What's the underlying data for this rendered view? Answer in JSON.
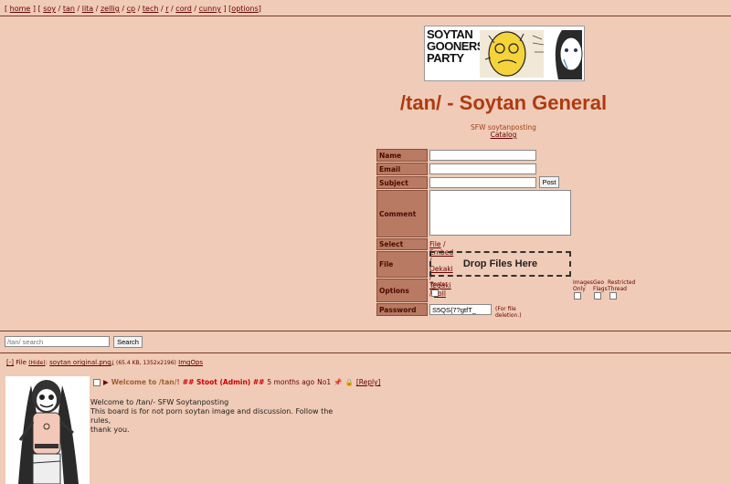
{
  "topnav": {
    "open": "[",
    "home": "home",
    "sep_close_open": "] [",
    "boards": [
      "soy",
      "tan",
      "lita",
      "zellig",
      "cp",
      "tech",
      "r",
      "cord",
      "cunny"
    ],
    "close_open": "] [",
    "options": "options",
    "close": "]"
  },
  "banner": {
    "text_lines": [
      "SOYTAN",
      "GOONERS",
      "PARTY"
    ]
  },
  "board": {
    "title": "/tan/ - Soytan General",
    "subtitle": "SFW soytanposting",
    "catalog": "Catalog"
  },
  "form": {
    "name_label": "Name",
    "email_label": "Email",
    "subject_label": "Subject",
    "post_button": "Post",
    "comment_label": "Comment",
    "select_label": "Select",
    "select_options": [
      "File",
      "Embed",
      "Oekaki",
      "Tegaki",
      "Poll"
    ],
    "file_label": "File",
    "drop_text": "Drop Files Here",
    "options_label": "Options",
    "poster_ids": "Poster IDs",
    "images_only_1": "Images",
    "images_only_2": "Only",
    "geo_flags_1": "Geo",
    "geo_flags_2": "Flags",
    "restricted_1": "Restricted",
    "restricted_2": "Thread",
    "password_label": "Password",
    "password_value": "S5QS{7?gtfT_",
    "password_note": "(For file deletion.)"
  },
  "search": {
    "placeholder": "/tan/ search",
    "button": "Search"
  },
  "thread": {
    "file_toggle": "[-]",
    "file_word": "File",
    "hide": "(Hide)",
    "colon": ":",
    "filename": "soytan original.png",
    "filesize": "(65.4 KB, 1352x2196)",
    "imgops": "ImgOps",
    "subject": "Welcome to /tan/!",
    "name": "## Stoot (Admin) ##",
    "time": "5 months ago",
    "post_no": "No1",
    "reply": "[Reply]",
    "body_line1": "Welcome to /tan/- SFW Soytanposting",
    "body_line2": "This board is for not porn soytan image and discussion. Follow the rules,",
    "body_line3": "thank you."
  }
}
